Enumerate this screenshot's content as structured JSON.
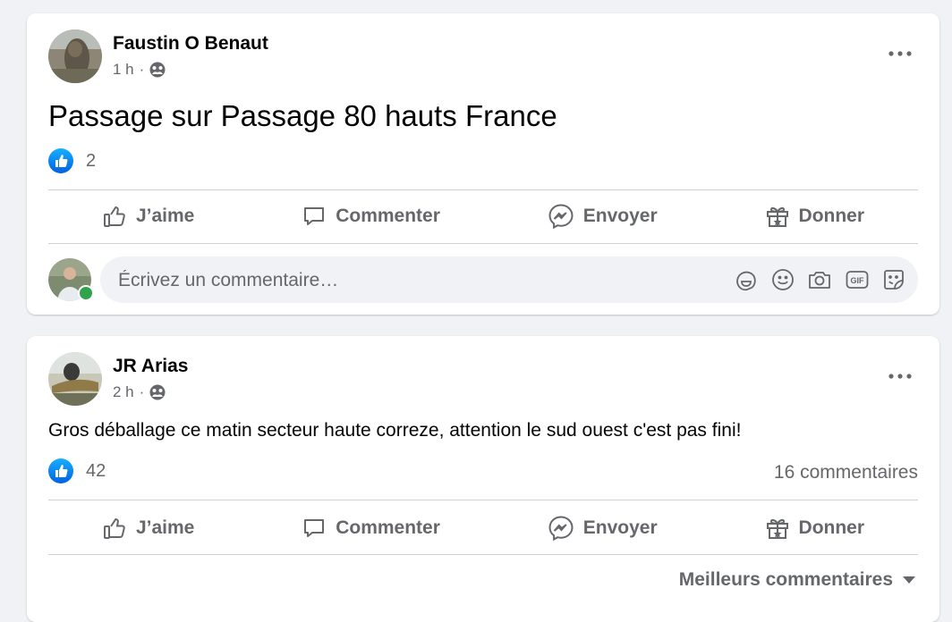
{
  "post1": {
    "author": "Faustin O Benaut",
    "time": "1 h",
    "separator": "·",
    "privacy_icon": "public-globe-icon",
    "text": "Passage sur Passage 80 hauts France",
    "likes": "2",
    "actions": {
      "like": "J’aime",
      "comment": "Commenter",
      "send": "Envoyer",
      "donate": "Donner"
    },
    "comment_placeholder": "Écrivez un commentaire…"
  },
  "post2": {
    "author": "JR Arias",
    "time": "2 h",
    "separator": "·",
    "privacy_icon": "public-globe-icon",
    "text": "Gros déballage ce matin secteur haute correze, attention le sud ouest c'est pas fini!",
    "likes": "42",
    "comments_count": "16 commentaires",
    "actions": {
      "like": "J’aime",
      "comment": "Commenter",
      "send": "Envoyer",
      "donate": "Donner"
    },
    "sort_label": "Meilleurs commentaires"
  },
  "colors": {
    "accent": "#1877f2",
    "secondary_text": "#65676b",
    "online": "#31a24c",
    "background": "#f0f2f5"
  }
}
